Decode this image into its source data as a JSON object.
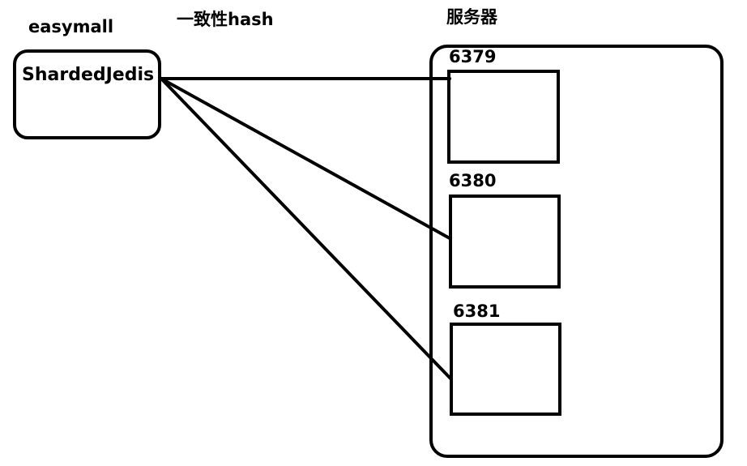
{
  "diagram": {
    "app_label": "easymall",
    "algorithm_label": "一致性hash",
    "servers_label": "服务器",
    "client": {
      "label": "ShardedJedis"
    },
    "nodes": [
      {
        "port": "6379"
      },
      {
        "port": "6380"
      },
      {
        "port": "6381"
      }
    ],
    "connections": [
      {
        "from": "client",
        "to": "6379"
      },
      {
        "from": "client",
        "to": "6380"
      },
      {
        "from": "client",
        "to": "6381"
      }
    ],
    "colors": {
      "stroke": "#000000",
      "background": "#ffffff"
    }
  }
}
